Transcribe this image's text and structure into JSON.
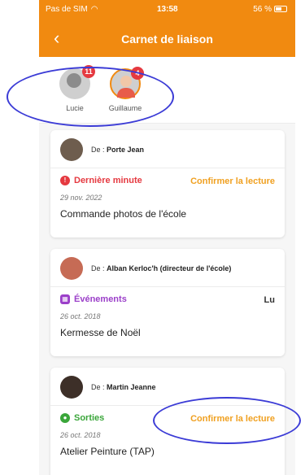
{
  "status_bar": {
    "carrier": "Pas de SIM",
    "time": "13:58",
    "battery": "56 %"
  },
  "header": {
    "title": "Carnet de liaison",
    "back_glyph": "‹"
  },
  "children": [
    {
      "name": "Lucie",
      "badge": "11",
      "selected": false
    },
    {
      "name": "Guillaume",
      "badge": "4",
      "selected": true
    }
  ],
  "messages": [
    {
      "from_prefix": "De :",
      "sender": "Porte Jean",
      "category": "Dernière minute",
      "category_color": "#e53940",
      "action": "Confirmer la lecture",
      "action_color": "#f0a020",
      "date": "29 nov. 2022",
      "subject": "Commande photos de l'école"
    },
    {
      "from_prefix": "De :",
      "sender": "Alban Kerloc'h (directeur de l'école)",
      "category": "Événements",
      "category_color": "#9b3fc9",
      "action": "Lu",
      "action_color": "#333333",
      "date": "26 oct. 2018",
      "subject": "Kermesse de Noël"
    },
    {
      "from_prefix": "De :",
      "sender": "Martin Jeanne",
      "category": "Sorties",
      "category_color": "#3aa63a",
      "action": "Confirmer la lecture",
      "action_color": "#f0a020",
      "date": "26 oct. 2018",
      "subject": "Atelier Peinture (TAP)"
    }
  ],
  "colors": {
    "accent": "#f18a10",
    "annotation": "#3b3bd6"
  }
}
